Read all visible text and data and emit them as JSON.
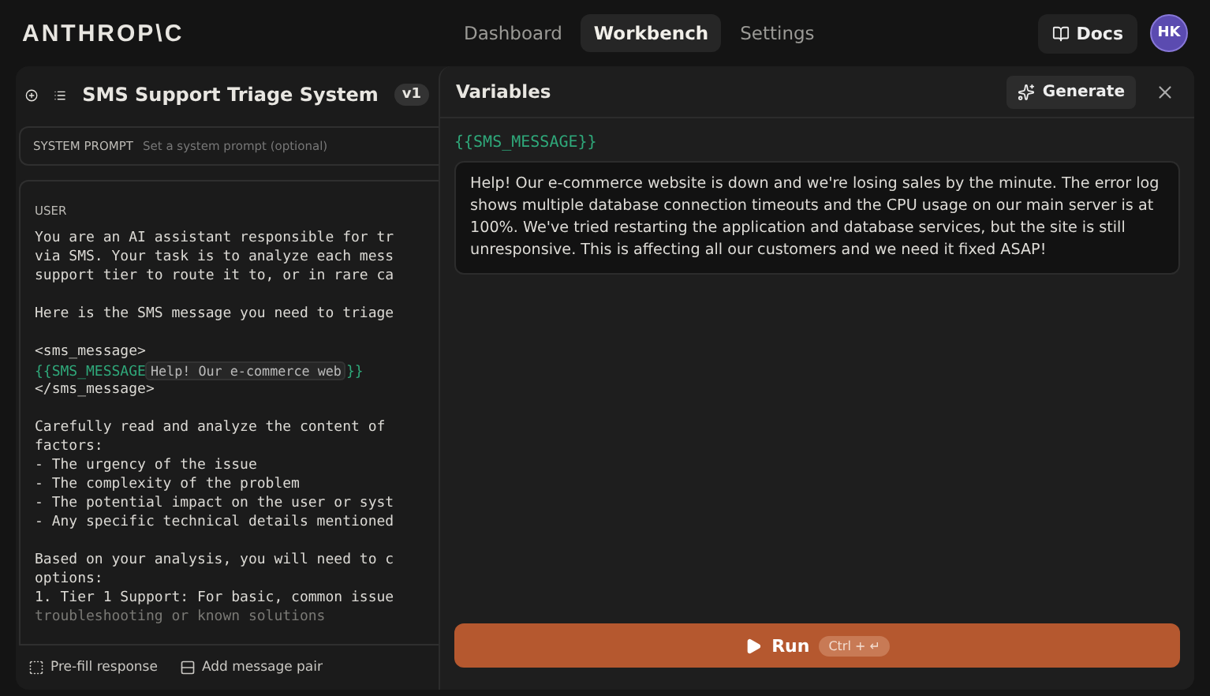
{
  "header": {
    "logo": "ANTHROP\\C",
    "nav": [
      {
        "label": "Dashboard",
        "selected": false
      },
      {
        "label": "Workbench",
        "selected": true
      },
      {
        "label": "Settings",
        "selected": false
      }
    ],
    "docs": "Docs",
    "avatar": "HK"
  },
  "prompt": {
    "title": "SMS Support Triage System",
    "version": "v1",
    "system_label": "SYSTEM PROMPT",
    "system_placeholder": "Set a system prompt (optional)",
    "user_label": "USER",
    "lines": [
      {
        "kind": "text",
        "text": "You are an AI assistant responsible for tr"
      },
      {
        "kind": "text",
        "text": "via SMS. Your task is to analyze each mess"
      },
      {
        "kind": "text",
        "text": "support tier to route it to, or in rare ca"
      },
      {
        "kind": "blank"
      },
      {
        "kind": "text",
        "text": "Here is the SMS message you need to triage"
      },
      {
        "kind": "blank"
      },
      {
        "kind": "text",
        "text": "<sms_message>"
      },
      {
        "kind": "variable",
        "open": "{{SMS_MESSAGE",
        "preview": "Help! Our e-commerce web",
        "close": "}}"
      },
      {
        "kind": "text",
        "text": "</sms_message>"
      },
      {
        "kind": "blank"
      },
      {
        "kind": "text",
        "text": "Carefully read and analyze the content of"
      },
      {
        "kind": "text",
        "text": "factors:"
      },
      {
        "kind": "text",
        "text": "- The urgency of the issue"
      },
      {
        "kind": "text",
        "text": "- The complexity of the problem"
      },
      {
        "kind": "text",
        "text": "- The potential impact on the user or syst"
      },
      {
        "kind": "text",
        "text": "- Any specific technical details mentioned"
      },
      {
        "kind": "blank"
      },
      {
        "kind": "text",
        "text": "Based on your analysis, you will need to c"
      },
      {
        "kind": "text",
        "text": "options:"
      },
      {
        "kind": "text",
        "text": "1. Tier 1 Support: For basic, common issue"
      },
      {
        "kind": "text",
        "text": "troubleshooting or known solutions"
      }
    ],
    "actions": [
      "Pre-fill response",
      "Add message pair"
    ]
  },
  "variables": {
    "title": "Variables",
    "generate": "Generate",
    "name": "{{SMS_MESSAGE}}",
    "value": "Help! Our e-commerce website is down and we're losing sales by the minute. The error log shows multiple database connection timeouts and the CPU usage on our main server is at 100%. We've tried restarting the application and database services, but the site is still unresponsive. This is affecting all our customers and we need it fixed ASAP!",
    "run": "Run",
    "shortcut": "Ctrl + ↵"
  }
}
